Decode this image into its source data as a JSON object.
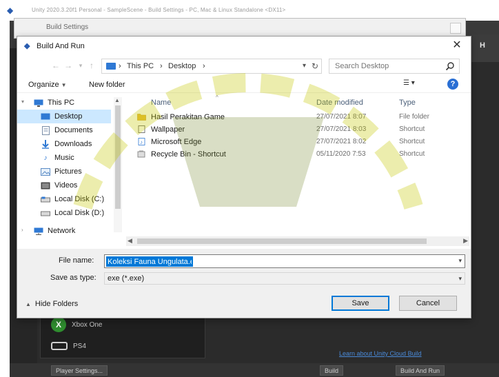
{
  "top_strip": {
    "path_text": "Unity 2020.3.20f1 Personal - SampleScene - Build Settings - PC, Mac & Linux Standalone <DX11>"
  },
  "outer_window": {
    "title": "Build Settings"
  },
  "dialog": {
    "title": "Build And Run",
    "close_label": "✕"
  },
  "address": {
    "crumbs": [
      "This PC",
      "Desktop"
    ],
    "separator": "›",
    "search_placeholder": "Search Desktop"
  },
  "toolbar": {
    "organize": "Organize",
    "new_folder": "New folder",
    "view_label": "☰ ▾",
    "help_label": "?"
  },
  "nav_items": [
    {
      "label": "This PC",
      "icon": "pc-icon"
    },
    {
      "label": "Desktop",
      "icon": "desktop-icon",
      "selected": true
    },
    {
      "label": "Documents",
      "icon": "documents-icon"
    },
    {
      "label": "Downloads",
      "icon": "downloads-icon"
    },
    {
      "label": "Music",
      "icon": "music-icon"
    },
    {
      "label": "Pictures",
      "icon": "pictures-icon"
    },
    {
      "label": "Videos",
      "icon": "videos-icon"
    },
    {
      "label": "Local Disk (C:)",
      "icon": "disk-icon"
    },
    {
      "label": "Local Disk (D:)",
      "icon": "disk-icon"
    },
    {
      "label": "Network",
      "icon": "network-icon"
    }
  ],
  "file_list": {
    "columns": {
      "name": "Name",
      "date": "Date modified",
      "type": "Type"
    },
    "rows": [
      {
        "name": "Hasil Perakitan Game",
        "date": "27/07/2021 8:07",
        "type": "File folder",
        "icon": "folder-icon"
      },
      {
        "name": "Wallpaper",
        "date": "27/07/2021 8:03",
        "type": "Shortcut",
        "icon": "file-icon"
      },
      {
        "name": "Microsoft Edge",
        "date": "27/07/2021 8:02",
        "type": "Shortcut",
        "icon": "music-file-icon"
      },
      {
        "name": "Recycle Bin - Shortcut",
        "date": "05/11/2020 7:53",
        "type": "Shortcut",
        "icon": "shortcut-icon"
      }
    ]
  },
  "form": {
    "file_name_label": "File name:",
    "file_name_value": "Koleksi Fauna Ungulata.exe",
    "save_type_label": "Save as type:",
    "save_type_value": "exe (*.exe)"
  },
  "buttons": {
    "hide_folders": "Hide Folders",
    "save": "Save",
    "cancel": "Cancel"
  },
  "background_app": {
    "header_right": "H",
    "xbox_label": "Xbox One",
    "device_label": "PS4",
    "link": "Learn about Unity Cloud Build",
    "bottom_left": "Player Settings...",
    "bottom_mid": "Build",
    "bottom_right": "Build And Run"
  },
  "colors": {
    "accent": "#0078d7",
    "selection": "#cce8ff",
    "folder": "#e8bd3a",
    "watermark": "#c4c700"
  }
}
